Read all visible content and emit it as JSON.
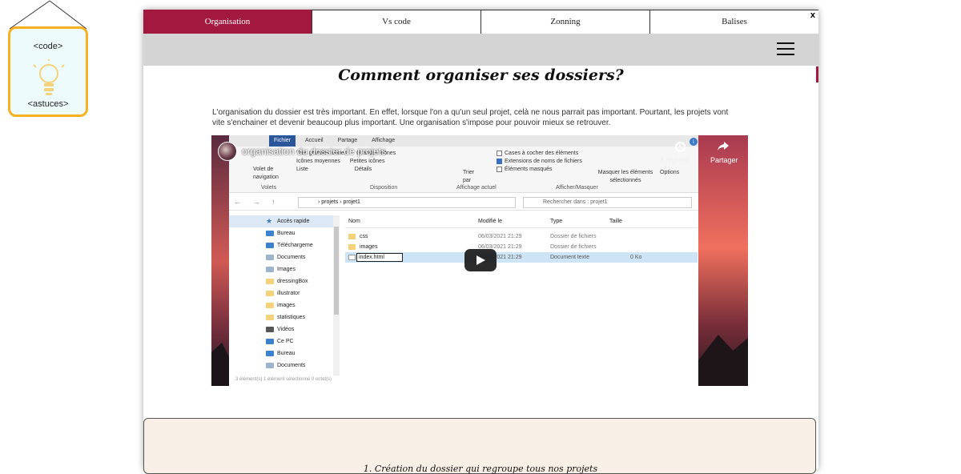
{
  "sign": {
    "top_label": "<code>",
    "bottom_label": "<astuces>"
  },
  "tabs": [
    {
      "label": "Organisation",
      "active": true
    },
    {
      "label": "Vs code",
      "active": false
    },
    {
      "label": "Zonning",
      "active": false
    },
    {
      "label": "Balises",
      "active": false
    }
  ],
  "close_label": "x",
  "page": {
    "title": "Comment organiser ses dossiers?",
    "intro": "L'organisation du dossier est très important. En effet, lorsque l'on a qu'un seul projet, celà ne nous parrait pas important. Pourtant, les projets vont vite s'enchainer et devenir beaucoup plus important. Une organisation s'impose pour pouvoir mieux se retrouver."
  },
  "video": {
    "title": "organisation du dossier de projets",
    "watch_later": "À regarder",
    "share": "Partager",
    "info": "i",
    "explorer": {
      "ribbon_tabs": [
        "Fichier",
        "Accueil",
        "Partage",
        "Affichage"
      ],
      "layout_options": [
        "Très grandes icônes",
        "Grandes icônes",
        "Icônes moyennes",
        "Petites icônes",
        "Liste",
        "Détails"
      ],
      "nav_pane_label": "Volet de navigation",
      "sort_label": "Trier par",
      "checkboxes": [
        {
          "label": "Cases à cocher des éléments",
          "checked": false
        },
        {
          "label": "Extensions de noms de fichiers",
          "checked": true
        },
        {
          "label": "Éléments masqués",
          "checked": false
        }
      ],
      "hide_selected": "Masquer les éléments sélectionnés",
      "options": "Options",
      "group_labels": [
        "Volets",
        "Disposition",
        "Affichage actuel",
        "Afficher/Masquer"
      ],
      "path": "›  projets  ›  projet1",
      "search_placeholder": "Rechercher dans : projet1",
      "nav_items": [
        {
          "label": "Accès rapide",
          "icon": "star"
        },
        {
          "label": "Bureau",
          "icon": "blue"
        },
        {
          "label": "Téléchargeme",
          "icon": "blue"
        },
        {
          "label": "Documents",
          "icon": "doc"
        },
        {
          "label": "Images",
          "icon": "doc"
        },
        {
          "label": "dressingBox",
          "icon": "folder"
        },
        {
          "label": "illustrator",
          "icon": "folder"
        },
        {
          "label": "images",
          "icon": "folder"
        },
        {
          "label": "statistiques",
          "icon": "folder"
        },
        {
          "label": "Vidéos",
          "icon": "doc"
        },
        {
          "label": "Ce PC",
          "icon": "blue"
        },
        {
          "label": "Bureau",
          "icon": "blue"
        },
        {
          "label": "Documents",
          "icon": "doc"
        }
      ],
      "columns": [
        "Nom",
        "Modifié le",
        "Type",
        "Taille"
      ],
      "files": [
        {
          "name": "css",
          "modified": "06/03/2021 21:29",
          "type": "Dossier de fichiers",
          "size": ""
        },
        {
          "name": "images",
          "modified": "06/03/2021 21:29",
          "type": "Dossier de fichiers",
          "size": ""
        },
        {
          "name": "index.html",
          "modified": "06/03/2021 21:29",
          "type": "Document texte",
          "size": "0 Ko"
        }
      ],
      "status": "3 élément(s)    1 élément sélectionné  0 octet(s)"
    }
  },
  "section": {
    "title": "1. Création du dossier qui regroupe tous nos projets"
  },
  "colors": {
    "accent": "#a3183e",
    "sign_border": "#f5b120",
    "card_bg": "#f8f0e6"
  }
}
